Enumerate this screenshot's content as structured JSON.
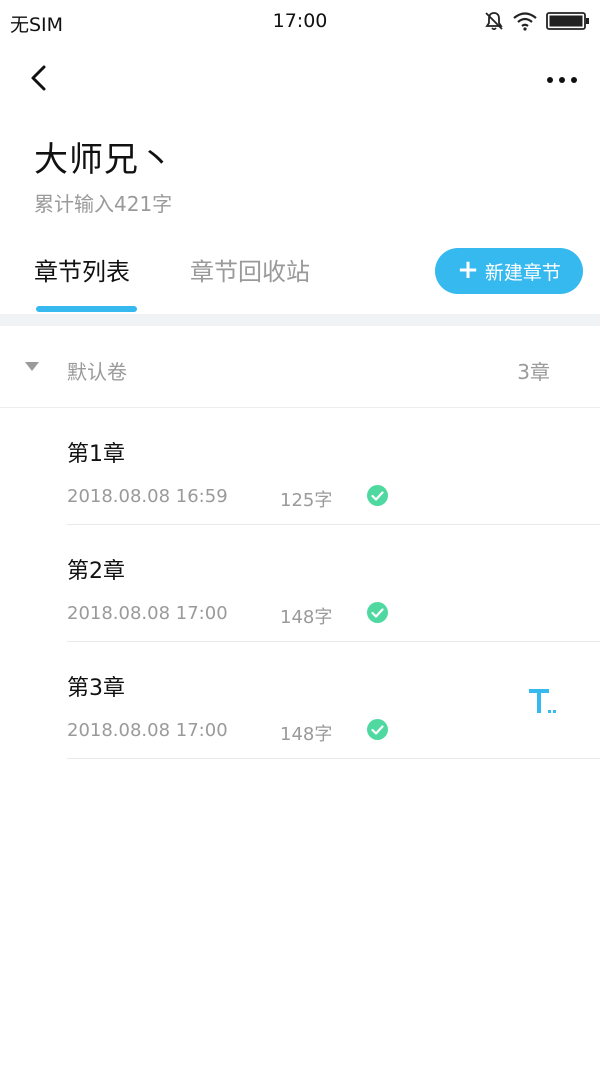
{
  "status_bar": {
    "carrier": "无SIM",
    "time": "17:00",
    "icons": [
      "bell-muted-icon",
      "wifi-icon",
      "battery-icon"
    ]
  },
  "nav": {
    "back_icon": "chevron-left-icon",
    "more_icon": "more-dots-icon"
  },
  "book": {
    "title": "大师兄丶",
    "word_count": "累计输入421字"
  },
  "tabs": {
    "items": [
      {
        "label": "章节列表",
        "active": true
      },
      {
        "label": "章节回收站",
        "active": false
      }
    ],
    "new_chapter_label": "新建章节",
    "accent_color": "#35b9ef"
  },
  "volume": {
    "name": "默认卷",
    "count": "3章"
  },
  "chapters": [
    {
      "title": "第1章",
      "date": "2018.08.08 16:59",
      "words": "125字",
      "status": "synced"
    },
    {
      "title": "第2章",
      "date": "2018.08.08 17:00",
      "words": "148字",
      "status": "synced"
    },
    {
      "title": "第3章",
      "date": "2018.08.08 17:00",
      "words": "148字",
      "status": "synced"
    }
  ],
  "colors": {
    "accent": "#35b9ef",
    "check": "#4fd9a0",
    "secondary_text": "#9a9a9a"
  }
}
